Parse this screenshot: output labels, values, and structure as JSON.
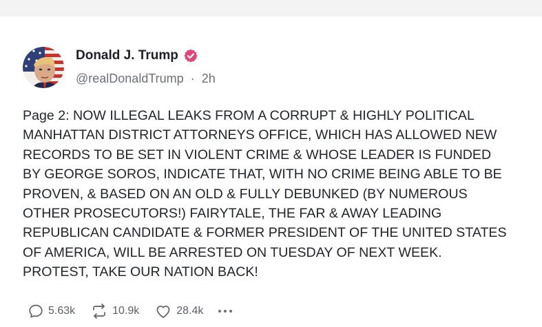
{
  "author": {
    "display_name": "Donald J. Trump",
    "handle": "@realDonaldTrump",
    "separator": "·",
    "time_ago": "2h",
    "verified_color": "#e0457b"
  },
  "post": {
    "lines": [
      "Page 2: NOW ILLEGAL LEAKS FROM A CORRUPT & HIGHLY POLITICAL",
      "MANHATTAN DISTRICT ATTORNEYS OFFICE, WHICH HAS ALLOWED NEW",
      "RECORDS TO BE SET IN VIOLENT CRIME & WHOSE LEADER IS FUNDED",
      "BY GEORGE SOROS, INDICATE THAT, WITH NO CRIME BEING ABLE TO BE",
      "PROVEN, & BASED ON AN OLD & FULLY DEBUNKED (BY NUMEROUS",
      "OTHER PROSECUTORS!) FAIRYTALE, THE FAR & AWAY LEADING",
      "REPUBLICAN CANDIDATE & FORMER PRESIDENT OF THE UNITED STATES",
      "OF AMERICA, WILL BE ARRESTED ON TUESDAY OF NEXT WEEK.",
      "PROTEST, TAKE OUR NATION BACK!"
    ]
  },
  "actions": {
    "replies": "5.63k",
    "reposts": "10.9k",
    "likes": "28.4k"
  },
  "icons": {
    "reply": "comment-bubble-icon",
    "repost": "repost-arrows-icon",
    "like": "heart-icon",
    "more": "more-dots-icon",
    "verified": "verified-badge-icon"
  }
}
